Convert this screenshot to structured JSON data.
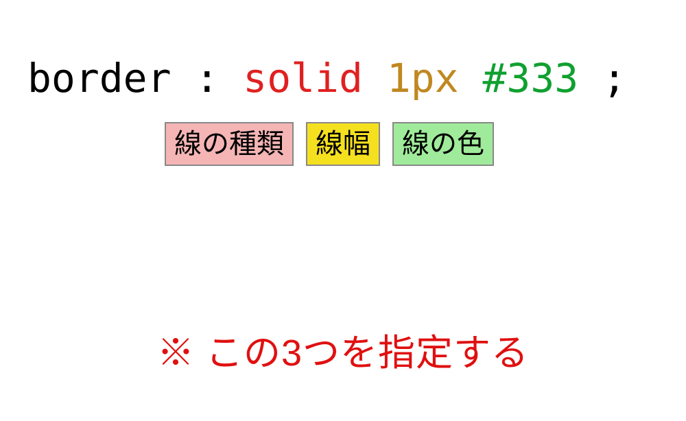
{
  "code": {
    "property": "border",
    "colon": " : ",
    "value_style": "solid",
    "space1": " ",
    "value_width": "1px",
    "space2": " ",
    "value_color": "#333",
    "semicolon": " ;"
  },
  "labels": {
    "style": "線の種類",
    "width": "線幅",
    "color": "線の色"
  },
  "note": "※ この3つを指定する"
}
